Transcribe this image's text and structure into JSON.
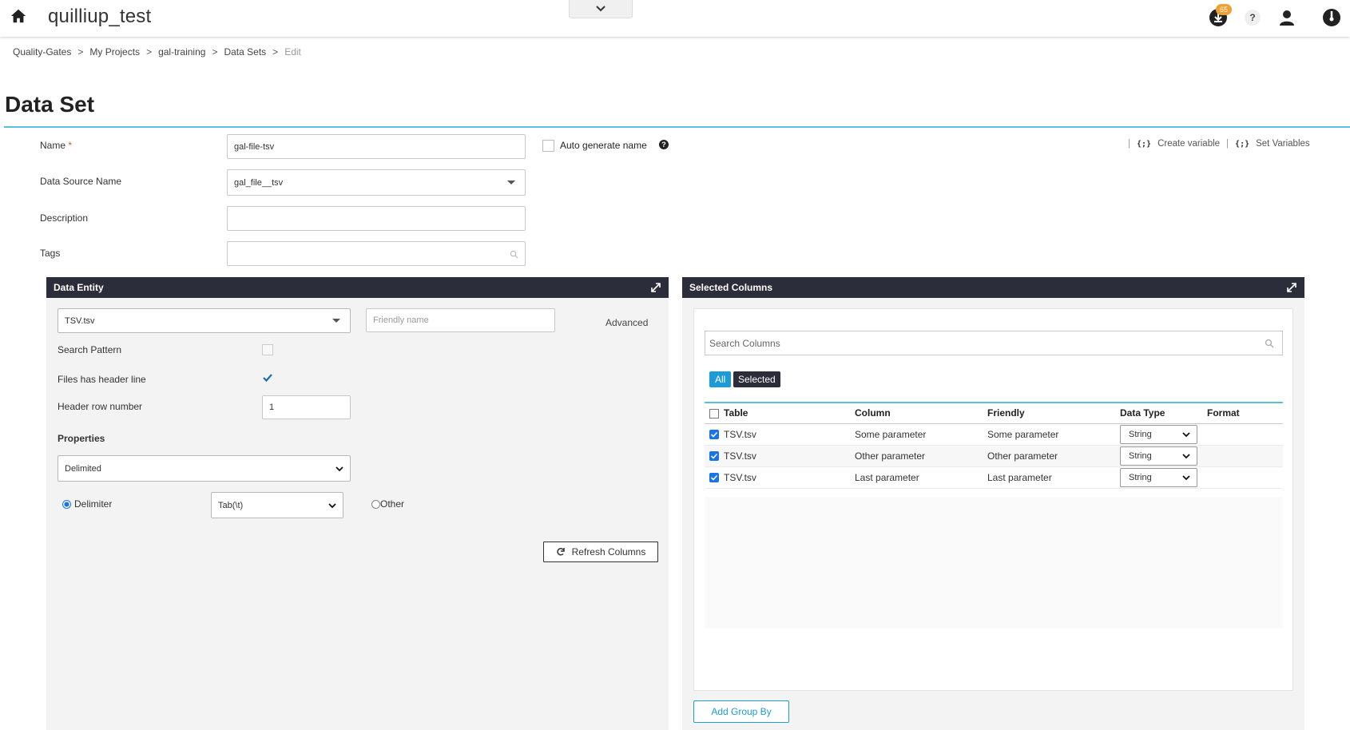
{
  "header": {
    "app_title": "quilliup_test",
    "notification_count": "65",
    "help_label": "?"
  },
  "breadcrumb": {
    "items": [
      "Quality-Gates",
      "My Projects",
      "gal-training",
      "Data Sets"
    ],
    "current": "Edit",
    "separator": ">"
  },
  "page": {
    "title": "Data Set"
  },
  "form": {
    "name_label": "Name",
    "required_mark": "*",
    "name_value": "gal-file-tsv",
    "auto_generate_label": "Auto generate name",
    "auto_generate_checked": false,
    "data_source_label": "Data Source Name",
    "data_source_value": "gal_file__tsv",
    "description_label": "Description",
    "description_value": "",
    "tags_label": "Tags",
    "tags_value": ""
  },
  "variables": {
    "separator": "|",
    "brace": "{;}",
    "create_label": "Create variable",
    "set_label": "Set Variables"
  },
  "data_entity": {
    "header": "Data Entity",
    "entity_value": "TSV.tsv",
    "friendly_placeholder": "Friendly name",
    "advanced_label": "Advanced",
    "search_pattern_label": "Search Pattern",
    "search_pattern_checked": false,
    "header_line_label": "Files has header line",
    "header_line_checked": true,
    "header_row_label": "Header row number",
    "header_row_value": "1",
    "properties_label": "Properties",
    "format_value": "Delimited",
    "delimiter_label": "Delimiter",
    "delimiter_value": "Tab(\\t)",
    "other_label": "Other",
    "refresh_label": "Refresh Columns"
  },
  "selected_columns": {
    "header": "Selected Columns",
    "search_placeholder": "Search Columns",
    "filter_all": "All",
    "filter_selected": "Selected",
    "columns": [
      "Table",
      "Column",
      "Friendly",
      "Data Type",
      "Format"
    ],
    "rows": [
      {
        "checked": true,
        "table": "TSV.tsv",
        "column": "Some parameter",
        "friendly": "Some parameter",
        "data_type": "String",
        "format": ""
      },
      {
        "checked": true,
        "table": "TSV.tsv",
        "column": "Other parameter",
        "friendly": "Other parameter",
        "data_type": "String",
        "format": ""
      },
      {
        "checked": true,
        "table": "TSV.tsv",
        "column": "Last parameter",
        "friendly": "Last parameter",
        "data_type": "String",
        "format": ""
      }
    ],
    "add_group_by_label": "Add Group By"
  },
  "colors": {
    "accent": "#1c9bd6",
    "panel_header": "#2b2d3a",
    "title_rule": "#5bc0de",
    "badge": "#f0a030"
  }
}
